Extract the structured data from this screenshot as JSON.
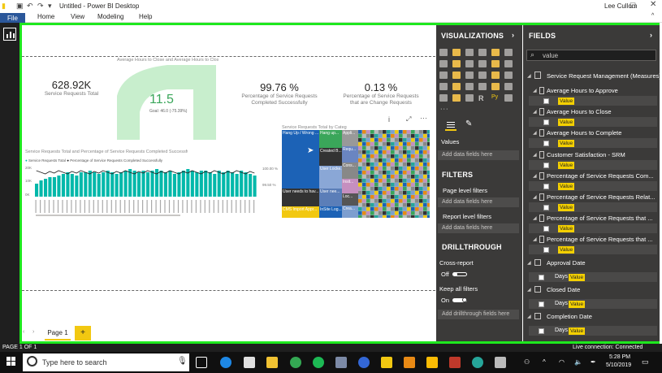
{
  "window": {
    "title": "Untitled - Power BI Desktop",
    "user": "Lee Cullom"
  },
  "ribbon": {
    "tabs": [
      "File",
      "Home",
      "View",
      "Modeling",
      "Help"
    ]
  },
  "kpis": [
    {
      "value": "628.92K",
      "label": "Service Requests Total"
    },
    {
      "value": "99.76 %",
      "label": "Percentage of Service Requests Completed Successfully"
    },
    {
      "value": "0.13 %",
      "label": "Percentage of Service Requests that are Change Requests"
    }
  ],
  "gauge": {
    "title": "Average Hours to Close and Average Hours to Close Goal",
    "value": "11.5",
    "sub": "Goal: 46.0 (-75.39%)",
    "fill": 0.25
  },
  "combo": {
    "title": "Service Requests Total and Percentage of Service Requests Completed Successfully by Month",
    "legend": [
      "Service Requests Total",
      "Percentage of Service Requests Completed Successfully"
    ],
    "y_left": [
      "20K",
      "10K",
      "0K"
    ],
    "y_right": [
      "100.00 %",
      "99.50 %"
    ]
  },
  "chart_data": {
    "type": "bar",
    "title": "Service Requests Total and Percentage of Service Requests Completed Successfully by Month",
    "series": [
      {
        "name": "Service Requests Total",
        "values": [
          8,
          10,
          11,
          12,
          12,
          13,
          14,
          15,
          14,
          13,
          15,
          15,
          16,
          15,
          14,
          15,
          16,
          15,
          14,
          15,
          16,
          17,
          16,
          15,
          16,
          15,
          16,
          17,
          16,
          15,
          16,
          14,
          15,
          16,
          17,
          16,
          15,
          16,
          16,
          15,
          14,
          16,
          15,
          16,
          15,
          14,
          16,
          15,
          14,
          13
        ]
      }
    ],
    "ylim": [
      0,
      20
    ]
  },
  "treemap": {
    "title": "Service Requests Total by Category",
    "cells": [
      "Hang Up / Wrong ...",
      "Hang up...",
      "Created B...",
      "User Locke...",
      "User needs to hav...",
      "User nee...",
      "CMS Import Appr...",
      "InSite Log...",
      "Appli...",
      "Requ...",
      "Cons...",
      "Insit...",
      "Loc...",
      "Crea..."
    ]
  },
  "visualizations": {
    "title": "VISUALIZATIONS",
    "values_label": "Values",
    "add_data": "Add data fields here",
    "filters": "FILTERS",
    "page_level": "Page level filters",
    "report_level": "Report level filters",
    "drillthrough": "DRILLTHROUGH",
    "cross_report": "Cross-report",
    "off": "Off",
    "keep_filters": "Keep all filters",
    "on": "On",
    "add_drill": "Add drillthrough fields here"
  },
  "fields": {
    "title": "FIELDS",
    "search": "value",
    "group": "Service Request Management (Measures)",
    "measures": [
      "Average Hours to Approve",
      "Average Hours to Close",
      "Average Hours to Complete",
      "Customer Satisfaction - SRM",
      "Percentage of Service Requests Com...",
      "Percentage of Service Requests Relat...",
      "Percentage of Service Requests that ...",
      "Percentage of Service Requests that ..."
    ],
    "value_label": "Value",
    "tables": [
      "Approval Date",
      "Closed Date",
      "Completion Date"
    ],
    "days": "Days",
    "days_value": "Value"
  },
  "pages": {
    "current": "Page 1",
    "add": "+"
  },
  "status": {
    "left": "PAGE 1 OF 1",
    "right": "Live connection: Connected"
  },
  "taskbar": {
    "search": "Type here to search",
    "time": "5:28 PM",
    "date": "5/10/2019"
  }
}
